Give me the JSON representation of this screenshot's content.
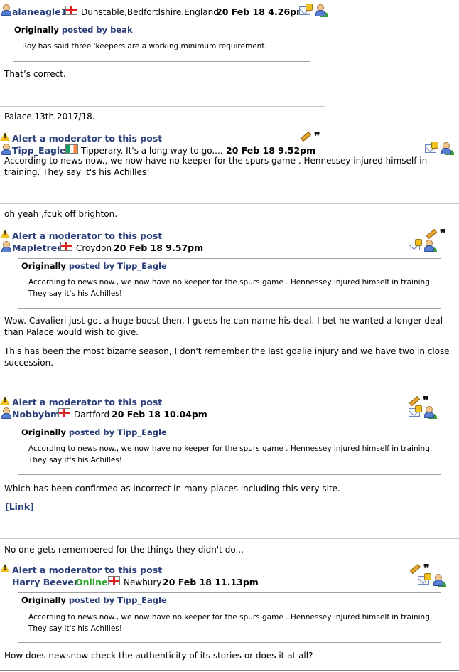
{
  "posts": [
    {
      "username": "alaneagle1",
      "location": "Dunstable,Bedfordshire.England",
      "date": "20 Feb 18 4.26pm",
      "quote_label": "Originally",
      "quote_posted_by": "posted by beak",
      "quote_text": "Roy has said three 'keepers are a working minimum requirement.",
      "body": "That’s correct.",
      "signature": "Palace 13th 2017/18."
    },
    {
      "alert": "Alert a moderator to this post",
      "username": "Tipp_Eagle",
      "location": "Tipperary. It's a long way to go....",
      "date": "20 Feb 18 9.52pm",
      "body": "According to news now., we now have no keeper for the spurs game . Hennessey injured himself in training. They say it's his Achilles!",
      "signature": "oh yeah ,fcuk off brighton."
    },
    {
      "alert": "Alert a moderator to this post",
      "username": "Mapletree",
      "location": "Croydon",
      "date": "20 Feb 18 9.57pm",
      "quote_label": "Originally",
      "quote_posted_by": "posted by Tipp_Eagle",
      "quote_text": "According to news now., we now have no keeper for the spurs game . Hennessey injured himself in training. They say it's his Achilles!",
      "body_p1": "Wow. Cavalieri just got a huge boost then, I guess he can name his deal. I bet he wanted a longer deal than Palace would wish to give.",
      "body_p2": "This has been the most bizarre season, I don't remember the last goalie injury and we have two in close succession."
    },
    {
      "alert": "Alert a moderator to this post",
      "username": "Nobbybm",
      "location": "Dartford",
      "date": "20 Feb 18 10.04pm",
      "quote_label": "Originally",
      "quote_posted_by": "posted by Tipp_Eagle",
      "quote_text": "According to news now., we now have no keeper for the spurs game . Hennessey injured himself in training. They say it's his Achilles!",
      "body": "Which has been confirmed as incorrect in many places including this very site.",
      "link": "[Link]",
      "signature": "No one gets remembered for the things they didn't do..."
    },
    {
      "alert": "Alert a moderator to this post",
      "username": "Harry Beever",
      "online": "Online",
      "location": "Newbury",
      "date": "20 Feb 18 11.13pm",
      "quote_label": "Originally",
      "quote_posted_by": "posted by Tipp_Eagle",
      "quote_text": "According to news now., we now have no keeper for the spurs game . Hennessey injured himself in training. They say it's his Achilles!",
      "body": "How does newsnow check the authenticity of its stories or does it at all?"
    }
  ],
  "icons": {
    "user": "user-icon",
    "flag_england": "england-flag-icon",
    "flag_ireland": "ireland-flag-icon",
    "warning": "warning-icon",
    "edit": "pencil-icon",
    "quote": "quote-icon",
    "mail": "private-message-icon",
    "profile": "profile-icon"
  },
  "colors": {
    "username": "#2a3f7a",
    "online": "#2aa52a",
    "rule": "#a0a0a0"
  }
}
